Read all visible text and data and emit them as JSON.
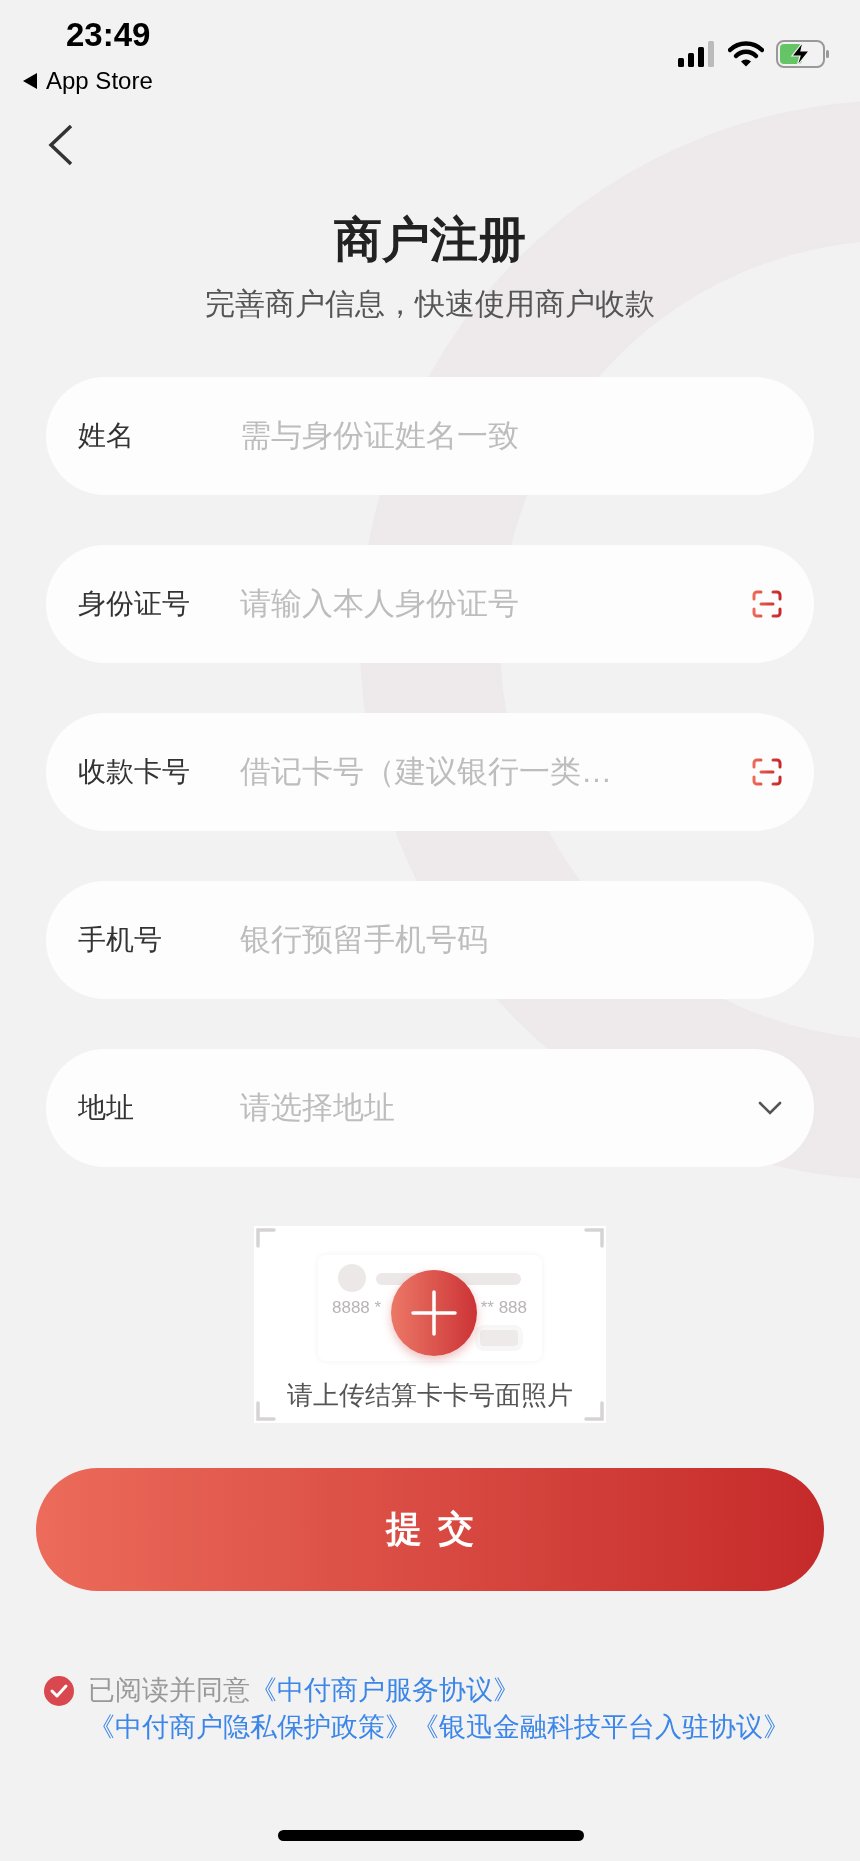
{
  "status_bar": {
    "time": "23:49",
    "back_label": "App Store"
  },
  "header": {
    "title": "商户注册",
    "subtitle": "完善商户信息，快速使用商户收款"
  },
  "fields": [
    {
      "label": "姓名",
      "placeholder": "需与身份证姓名一致",
      "kind": "text"
    },
    {
      "label": "身份证号",
      "placeholder": "请输入本人身份证号",
      "kind": "scan"
    },
    {
      "label": "收款卡号",
      "placeholder": "借记卡号（建议银行一类…",
      "kind": "scan"
    },
    {
      "label": "手机号",
      "placeholder": "银行预留手机号码",
      "kind": "text"
    },
    {
      "label": "地址",
      "placeholder": "请选择地址",
      "kind": "select"
    }
  ],
  "upload": {
    "hint": "请上传结算卡卡号面照片",
    "sample_left": "8888 *",
    "sample_right": "** 888"
  },
  "submit": {
    "label": "提交"
  },
  "agreement": {
    "checked": true,
    "prefix": "已阅读并同意",
    "links": [
      "《中付商户服务协议》",
      "《中付商户隐私保护政策》",
      "《银迅金融科技平台入驻协议》"
    ]
  }
}
